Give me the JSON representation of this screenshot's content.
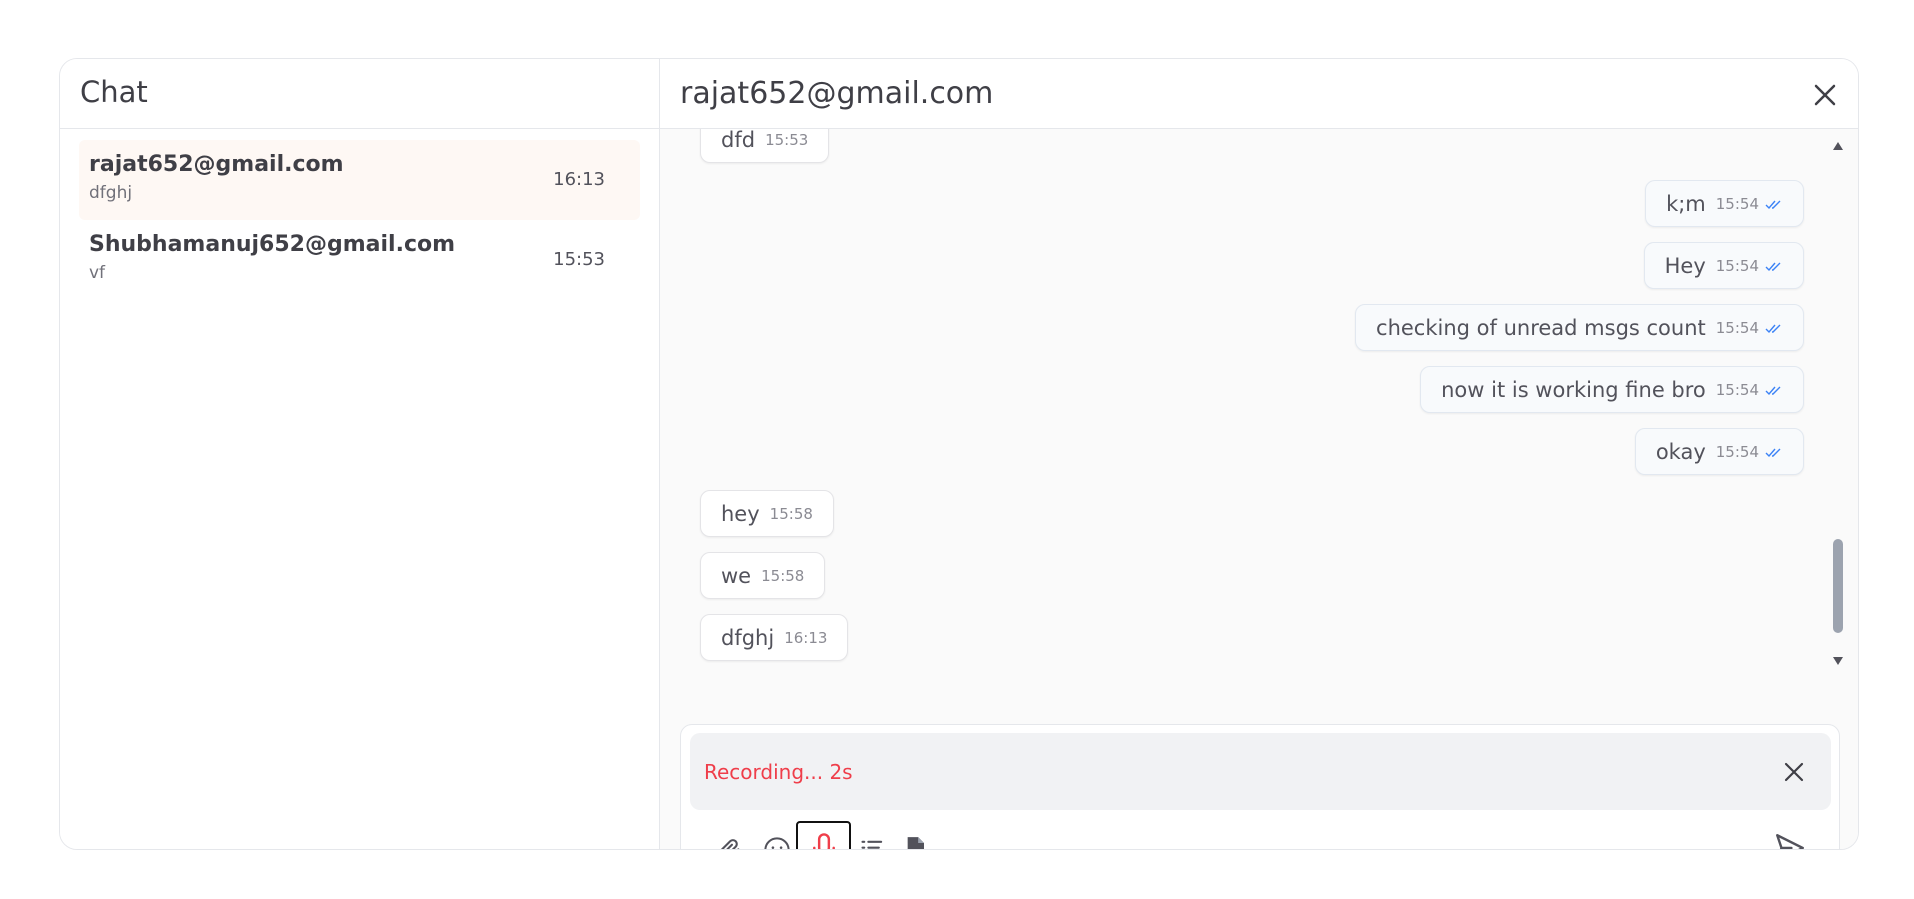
{
  "sidebar": {
    "title": "Chat",
    "conversations": [
      {
        "name": "rajat652@gmail.com",
        "preview": "dfghj",
        "time": "16:13",
        "active": true
      },
      {
        "name": "Shubhamanuj652@gmail.com",
        "preview": "vf",
        "time": "15:53",
        "active": false
      }
    ]
  },
  "chat": {
    "title": "rajat652@gmail.com",
    "messages": [
      {
        "direction": "in",
        "text": "dfd",
        "time": "15:53"
      },
      {
        "direction": "out",
        "text": "k;m",
        "time": "15:54"
      },
      {
        "direction": "out",
        "text": "Hey",
        "time": "15:54"
      },
      {
        "direction": "out",
        "text": "checking of unread msgs count",
        "time": "15:54"
      },
      {
        "direction": "out",
        "text": "now it is working fine bro",
        "time": "15:54"
      },
      {
        "direction": "out",
        "text": "okay",
        "time": "15:54"
      },
      {
        "direction": "in",
        "text": "hey",
        "time": "15:58"
      },
      {
        "direction": "in",
        "text": "we",
        "time": "15:58"
      },
      {
        "direction": "in",
        "text": "dfghj",
        "time": "16:13"
      }
    ]
  },
  "composer": {
    "recording_text": "Recording... 2s",
    "tools": [
      "attachment-icon",
      "emoji-icon",
      "microphone-icon",
      "checklist-add-icon",
      "pdf-icon"
    ],
    "send_icon": "send-icon"
  },
  "colors": {
    "recording": "#ef3e4a",
    "read_ticks": "#3b82f6",
    "active_conversation": "#fef8f4"
  }
}
